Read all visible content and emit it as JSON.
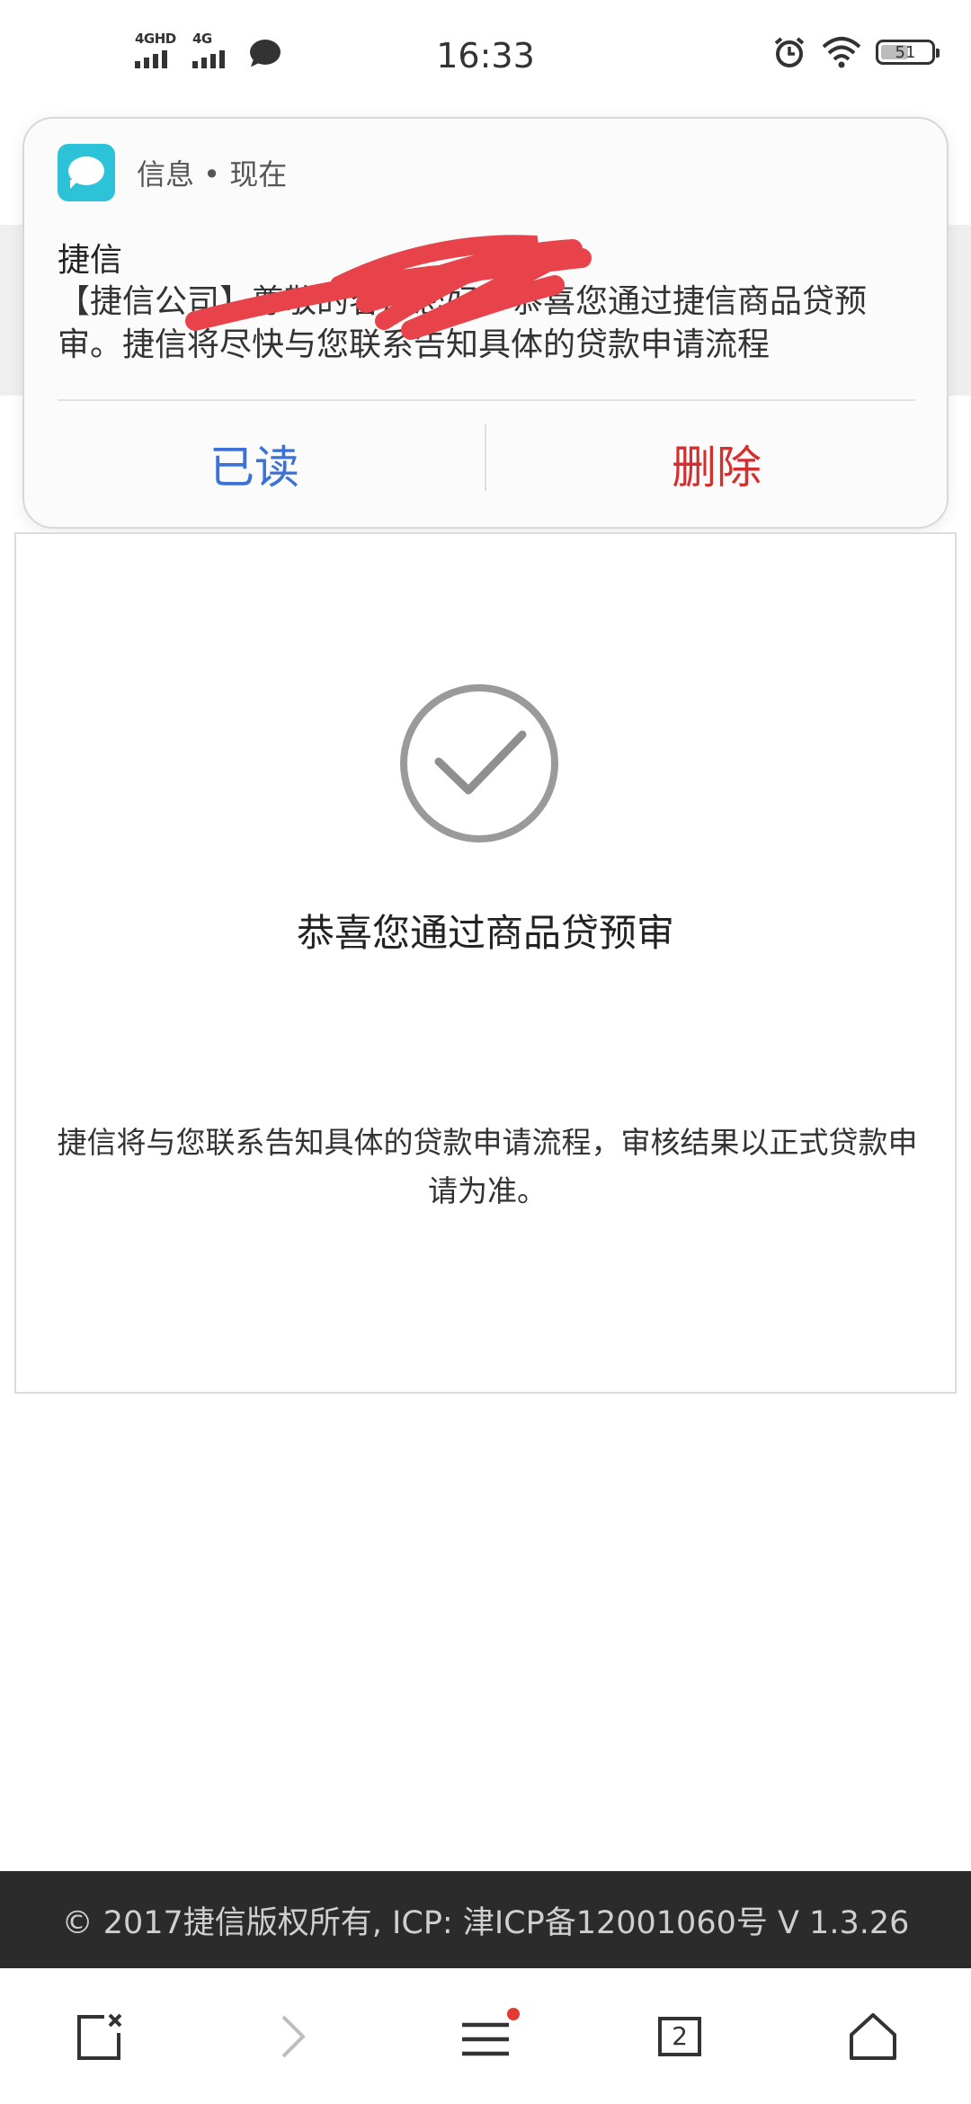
{
  "status_bar": {
    "signal1_label": "4GHD",
    "signal2_label": "4G",
    "time": "16:33",
    "battery": "51"
  },
  "notification": {
    "app_name": "信息 • 现在",
    "sender": "捷信",
    "body": "【捷信公司】尊敬的客户您好，恭喜您通过捷信商品贷预审。捷信将尽快与您联系告知具体的贷款申请流程",
    "action_read": "已读",
    "action_delete": "删除"
  },
  "card": {
    "title": "恭喜您通过商品贷预审",
    "description": "捷信将与您联系告知具体的贷款申请流程，审核结果以正式贷款申请为准。"
  },
  "footer": {
    "text": "© 2017捷信版权所有, ICP: 津ICP备12001060号   V 1.3.26"
  },
  "nav": {
    "tab_count": "2"
  },
  "colors": {
    "read_action": "#3a72d8",
    "delete_action": "#d32f2f",
    "footer_bg": "#2b2b2b",
    "app_icon": "#2cc2d8",
    "menu_badge": "#e53935"
  }
}
